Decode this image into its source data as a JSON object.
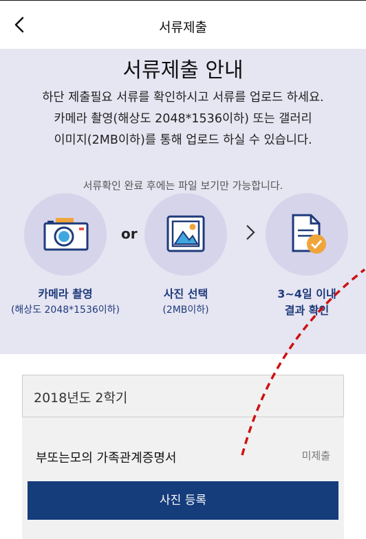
{
  "header": {
    "title": "서류제출"
  },
  "info": {
    "title": "서류제출 안내",
    "desc_line1": "하단 제출필요 서류를 확인하시고 서류를 업로드 하세요.",
    "desc_line2": "카메라 촬영(해상도 2048*1536이하) 또는 갤러리",
    "desc_line3": "이미지(2MB이하)를 통해 업로드 하실 수 있습니다.",
    "note": "서류확인 완료 후에는 파일 보기만 가능합니다.",
    "or_text": "or",
    "steps": [
      {
        "label": "카메라 촬영",
        "sub": "(해상도 2048*1536이하)"
      },
      {
        "label": "사진 선택",
        "sub": "(2MB이하)"
      },
      {
        "label_line1": "3~4일 이내",
        "label_line2": "결과 확인"
      }
    ]
  },
  "term": {
    "label": "2018년도 2학기"
  },
  "document": {
    "name": "부또는모의 가족관계증명서",
    "status": "미제출",
    "upload_label": "사진 등록"
  },
  "colors": {
    "accent": "#153c7b",
    "info_bg": "#e6e5f2",
    "circle": "#d6d4ea",
    "annotation": "#cc1111"
  }
}
